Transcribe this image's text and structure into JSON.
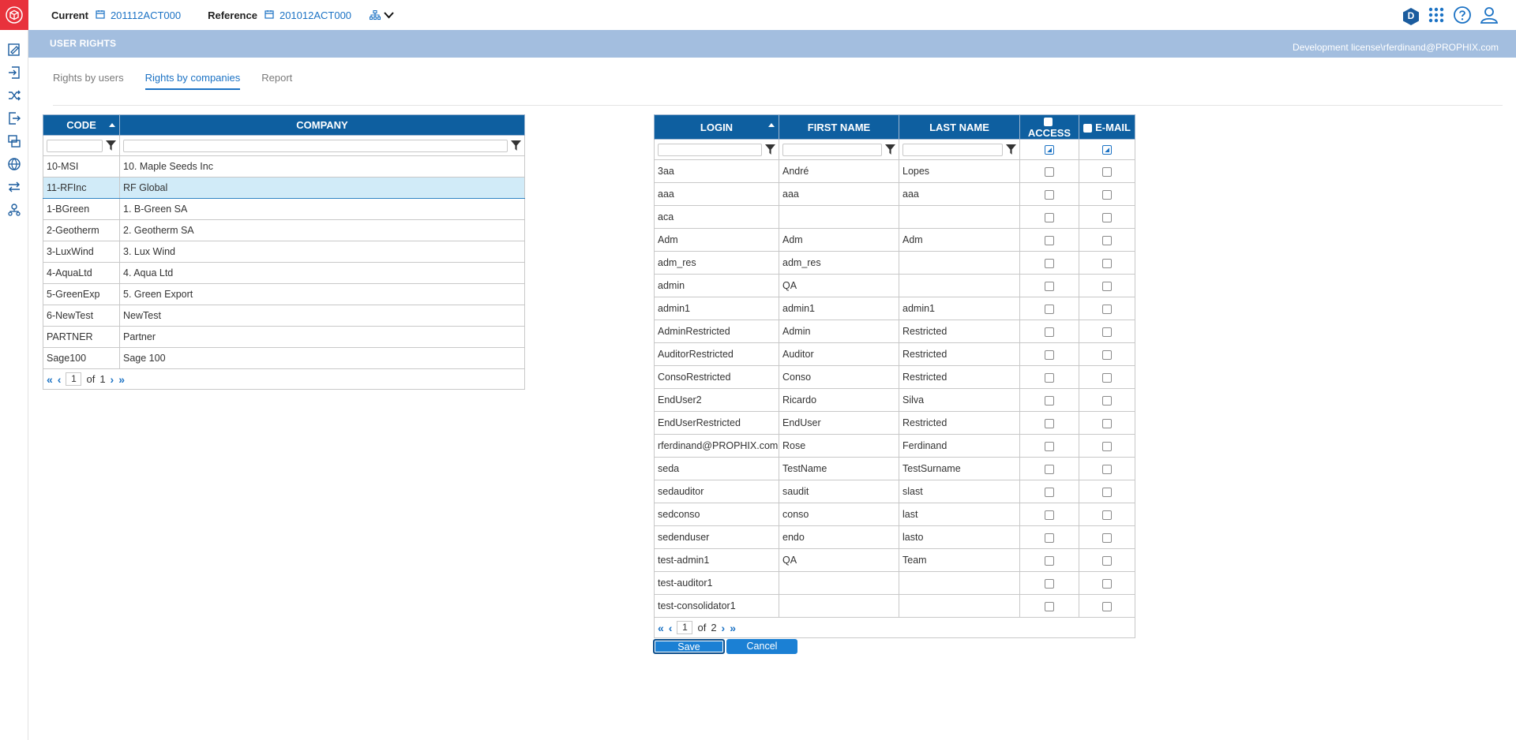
{
  "topbar": {
    "current_label": "Current",
    "current_value": "201112ACT000",
    "reference_label": "Reference",
    "reference_value": "201012ACT000",
    "avatar_letter": "D"
  },
  "band": {
    "title": "USER RIGHTS",
    "license": "Development license\\rferdinand@PROPHIX.com"
  },
  "tabs": [
    {
      "label": "Rights by users"
    },
    {
      "label": "Rights by companies"
    },
    {
      "label": "Report"
    }
  ],
  "companies": {
    "headers": {
      "code": "CODE",
      "company": "COMPANY"
    },
    "rows": [
      {
        "code": "10-MSI",
        "company": "10. Maple Seeds Inc"
      },
      {
        "code": "11-RFInc",
        "company": "RF Global"
      },
      {
        "code": "1-BGreen",
        "company": "1. B-Green SA"
      },
      {
        "code": "2-Geotherm",
        "company": "2. Geotherm SA"
      },
      {
        "code": "3-LuxWind",
        "company": "3. Lux Wind"
      },
      {
        "code": "4-AquaLtd",
        "company": "4. Aqua Ltd"
      },
      {
        "code": "5-GreenExp",
        "company": "5. Green Export"
      },
      {
        "code": "6-NewTest",
        "company": "NewTest"
      },
      {
        "code": "PARTNER",
        "company": "Partner"
      },
      {
        "code": "Sage100",
        "company": "Sage 100"
      }
    ],
    "pager": {
      "page": "1",
      "of_label": "of",
      "total": "1"
    }
  },
  "users": {
    "headers": {
      "login": "LOGIN",
      "first": "FIRST NAME",
      "last": "LAST NAME",
      "access": "ACCESS",
      "email": "E-MAIL"
    },
    "rows": [
      {
        "login": "3aa",
        "first": "André",
        "last": "Lopes"
      },
      {
        "login": "aaa",
        "first": "aaa",
        "last": "aaa"
      },
      {
        "login": "aca",
        "first": "",
        "last": ""
      },
      {
        "login": "Adm",
        "first": "Adm",
        "last": "Adm"
      },
      {
        "login": "adm_res",
        "first": "adm_res",
        "last": ""
      },
      {
        "login": "admin",
        "first": "QA",
        "last": ""
      },
      {
        "login": "admin1",
        "first": "admin1",
        "last": "admin1"
      },
      {
        "login": "AdminRestricted",
        "first": "Admin",
        "last": "Restricted"
      },
      {
        "login": "AuditorRestricted",
        "first": "Auditor",
        "last": "Restricted"
      },
      {
        "login": "ConsoRestricted",
        "first": "Conso",
        "last": "Restricted"
      },
      {
        "login": "EndUser2",
        "first": "Ricardo",
        "last": "Silva"
      },
      {
        "login": "EndUserRestricted",
        "first": "EndUser",
        "last": "Restricted"
      },
      {
        "login": "rferdinand@PROPHIX.com",
        "first": "Rose",
        "last": "Ferdinand"
      },
      {
        "login": "seda",
        "first": "TestName",
        "last": "TestSurname"
      },
      {
        "login": "sedauditor",
        "first": "saudit",
        "last": "slast"
      },
      {
        "login": "sedconso",
        "first": "conso",
        "last": "last"
      },
      {
        "login": "sedenduser",
        "first": "endo",
        "last": "lasto"
      },
      {
        "login": "test-admin1",
        "first": "QA",
        "last": "Team"
      },
      {
        "login": "test-auditor1",
        "first": "",
        "last": ""
      },
      {
        "login": "test-consolidator1",
        "first": "",
        "last": ""
      }
    ],
    "pager": {
      "page": "1",
      "of_label": "of",
      "total": "2"
    }
  },
  "buttons": {
    "save": "Save",
    "cancel": "Cancel"
  },
  "colors": {
    "accent": "#1b72c4",
    "header_bg": "#0e5fa0",
    "band_bg": "#a3bedf",
    "logo_bg": "#e8323c",
    "selected_row": "#d1ebf8"
  }
}
